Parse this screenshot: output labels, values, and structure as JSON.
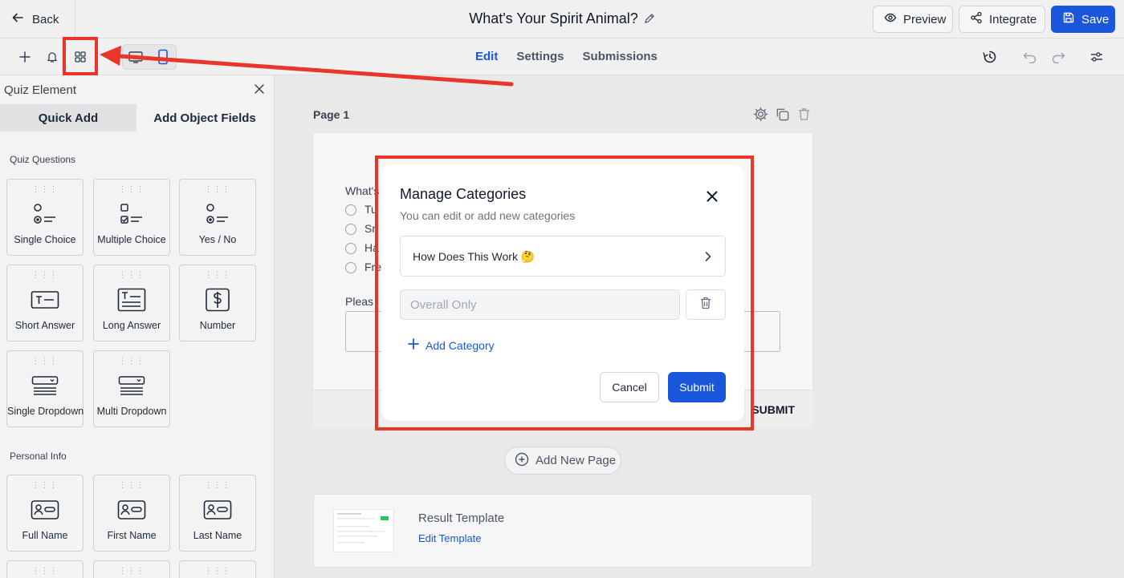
{
  "header": {
    "back_label": "Back",
    "title": "What's Your Spirit Animal?",
    "preview_label": "Preview",
    "integrate_label": "Integrate",
    "save_label": "Save"
  },
  "toolbar": {
    "tabs": [
      {
        "label": "Edit",
        "active": true
      },
      {
        "label": "Settings",
        "active": false
      },
      {
        "label": "Submissions",
        "active": false
      }
    ]
  },
  "panel": {
    "title": "Quiz Element",
    "tabs": [
      "Quick Add",
      "Add Object Fields"
    ],
    "sections": [
      {
        "label": "Quiz Questions",
        "items": [
          "Single Choice",
          "Multiple Choice",
          "Yes / No",
          "Short Answer",
          "Long Answer",
          "Number",
          "Single Dropdown",
          "Multi Dropdown"
        ]
      },
      {
        "label": "Personal Info",
        "items": [
          "Full Name",
          "First Name",
          "Last Name"
        ]
      }
    ]
  },
  "canvas": {
    "page_label": "Page 1",
    "question_partial": "What's",
    "options_partial": [
      "Tu",
      "Sn",
      "Ha",
      "Fre"
    ],
    "question2_partial": "Pleas",
    "submit_label": "SUBMIT",
    "add_page_label": "Add New Page",
    "result_title": "Result Template",
    "result_link": "Edit Template"
  },
  "modal": {
    "title": "Manage Categories",
    "subtitle": "You can edit or add new categories",
    "categories": [
      {
        "label": "How Does This Work 🤔"
      }
    ],
    "input_placeholder": "Overall Only",
    "input_value": "",
    "add_category_label": "Add Category",
    "cancel_label": "Cancel",
    "submit_label": "Submit"
  },
  "colors": {
    "accent": "#1a56db",
    "annotation": "#e8362b"
  }
}
